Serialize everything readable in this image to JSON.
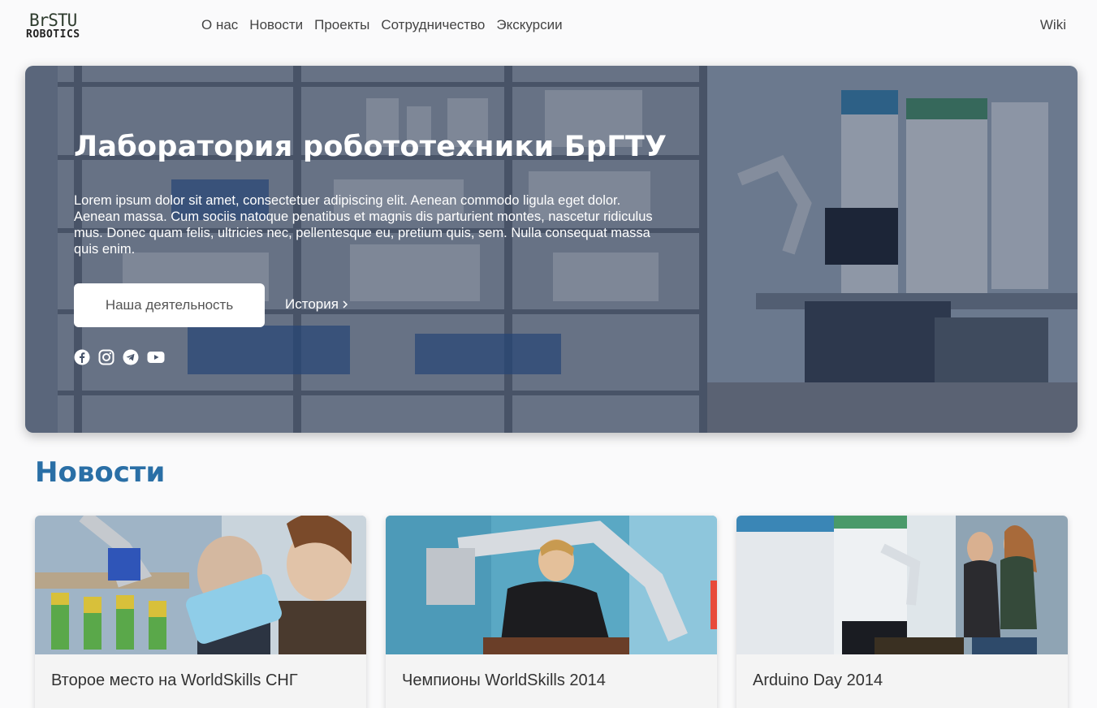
{
  "header": {
    "logo_line1": "BrSTU",
    "logo_line2": "ROBOTICS",
    "nav": [
      "О нас",
      "Новости",
      "Проекты",
      "Сотрудничество",
      "Экскурсии"
    ],
    "wiki": "Wiki"
  },
  "hero": {
    "title": "Лаборатория робототехники БрГТУ",
    "text": "Lorem ipsum dolor sit amet, consectetuer adipiscing elit. Aenean commodo ligula eget dolor. Aenean massa. Cum sociis natoque penatibus et magnis dis parturient montes, nascetur ridiculus mus. Donec quam felis, ultricies nec, pellentesque eu, pretium quis, sem. Nulla consequat massa quis enim.",
    "primary_button": "Наша деятельность",
    "secondary_link": "История",
    "socials": [
      "facebook-icon",
      "instagram-icon",
      "telegram-icon",
      "youtube-icon"
    ]
  },
  "news": {
    "title": "Новости",
    "cards": [
      {
        "title": "Второе место на WorldSkills СНГ"
      },
      {
        "title": "Чемпионы WorldSkills 2014"
      },
      {
        "title": "Arduino Day 2014"
      }
    ]
  },
  "colors": {
    "accent": "#2a6fa6",
    "hero_overlay": "#1e2d4a"
  }
}
